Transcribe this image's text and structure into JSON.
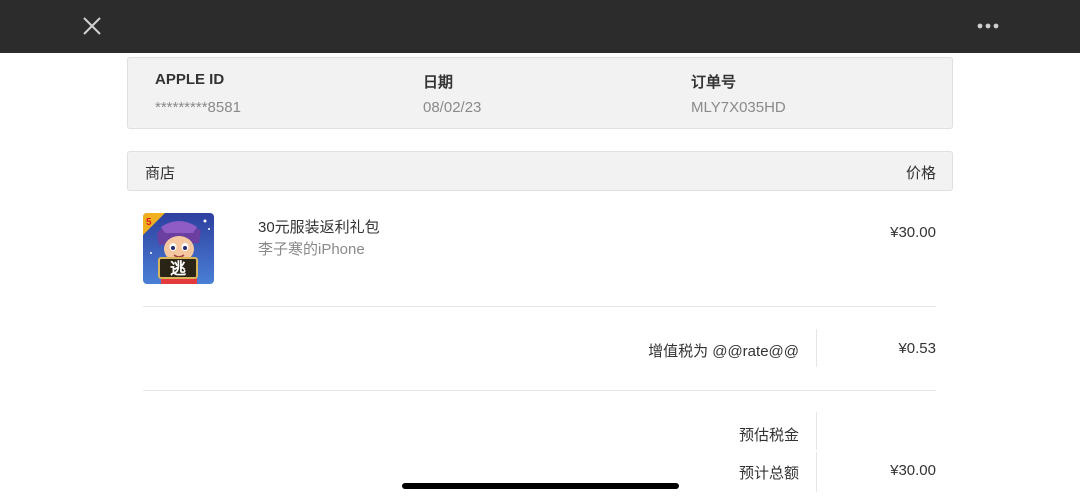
{
  "toolbar": {
    "close_icon": "close-icon",
    "more_icon": "more-options-icon"
  },
  "receipt_info": {
    "apple_id_label": "APPLE ID",
    "apple_id_value": "*********8581",
    "date_label": "日期",
    "date_value": "08/02/23",
    "order_label": "订单号",
    "order_value": "MLY7X035HD"
  },
  "table": {
    "store_header": "商店",
    "price_header": "价格"
  },
  "item": {
    "icon": "game-app-icon",
    "icon_badge_text": "逃",
    "name": "30元服装返利礼包",
    "device": "李子寒的iPhone",
    "price": "¥30.00"
  },
  "summary": {
    "vat_label": "增值税为 @@rate@@",
    "vat_value": "¥0.53",
    "estimated_tax_label": "预估税金",
    "estimated_total_label": "预计总额",
    "estimated_total_value": "¥30.00"
  },
  "colors": {
    "topbar": "#2c2c2c",
    "header_background": "#f2f2f2",
    "secondary_text": "#8a8a8a"
  }
}
